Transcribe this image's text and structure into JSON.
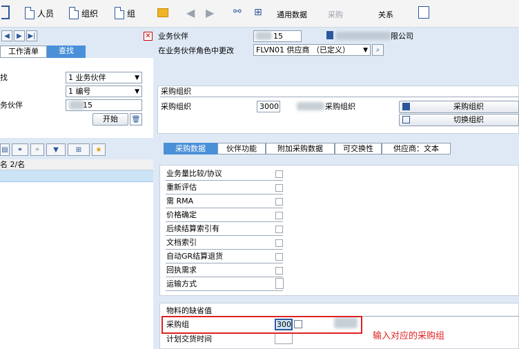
{
  "toolbar": {
    "person_label": "人员",
    "org_label": "组织",
    "group_label": "组",
    "general_data_label": "通用数据",
    "purchasing_label": "采购",
    "relations_label": "关系"
  },
  "left": {
    "worklist_tab": "工作清单",
    "find_tab": "查找",
    "find_label": "找",
    "find_by_select": "1 业务伙伴",
    "by_select": "1 编号",
    "bp_label": "务伙伴",
    "bp_value": "15",
    "start_button": "开始",
    "list_header": "名 2/名"
  },
  "header": {
    "bp_label": "业务伙伴",
    "bp_value": "15",
    "bp_company": "限公司",
    "role_label": "在业务伙伴角色中更改",
    "role_value": "FLVN01 供应商 （已定义）"
  },
  "porg": {
    "section_title": "采购组织",
    "label": "采购组织",
    "value": "3000",
    "desc_suffix": "采购组织",
    "porg_button": "采购组织",
    "switch_button": "切换组织"
  },
  "tabs": [
    "采购数据",
    "伙伴功能",
    "附加采购数据",
    "可交换性",
    "供应商：文本"
  ],
  "control_rows": [
    {
      "label": "业务量比较/协议",
      "type": "checkbox"
    },
    {
      "label": "重新评估",
      "type": "checkbox"
    },
    {
      "label": "需 RMA",
      "type": "checkbox"
    },
    {
      "label": "价格确定",
      "type": "checkbox"
    },
    {
      "label": "后续结算索引有",
      "type": "checkbox"
    },
    {
      "label": "文档索引",
      "type": "checkbox"
    },
    {
      "label": "自动GR结算退货",
      "type": "checkbox"
    },
    {
      "label": "回执需求",
      "type": "checkbox"
    },
    {
      "label": "运输方式",
      "type": "field"
    }
  ],
  "defaults": {
    "section_title": "物料的缺省值",
    "pgroup_label": "采购组",
    "pgroup_value": "300",
    "delivery_label": "计划交货时间"
  },
  "annotation": {
    "text": "输入对应的采购组",
    "color": "#e02020"
  },
  "colors": {
    "accent": "#4a90d9",
    "highlight_box": "#e02020"
  }
}
